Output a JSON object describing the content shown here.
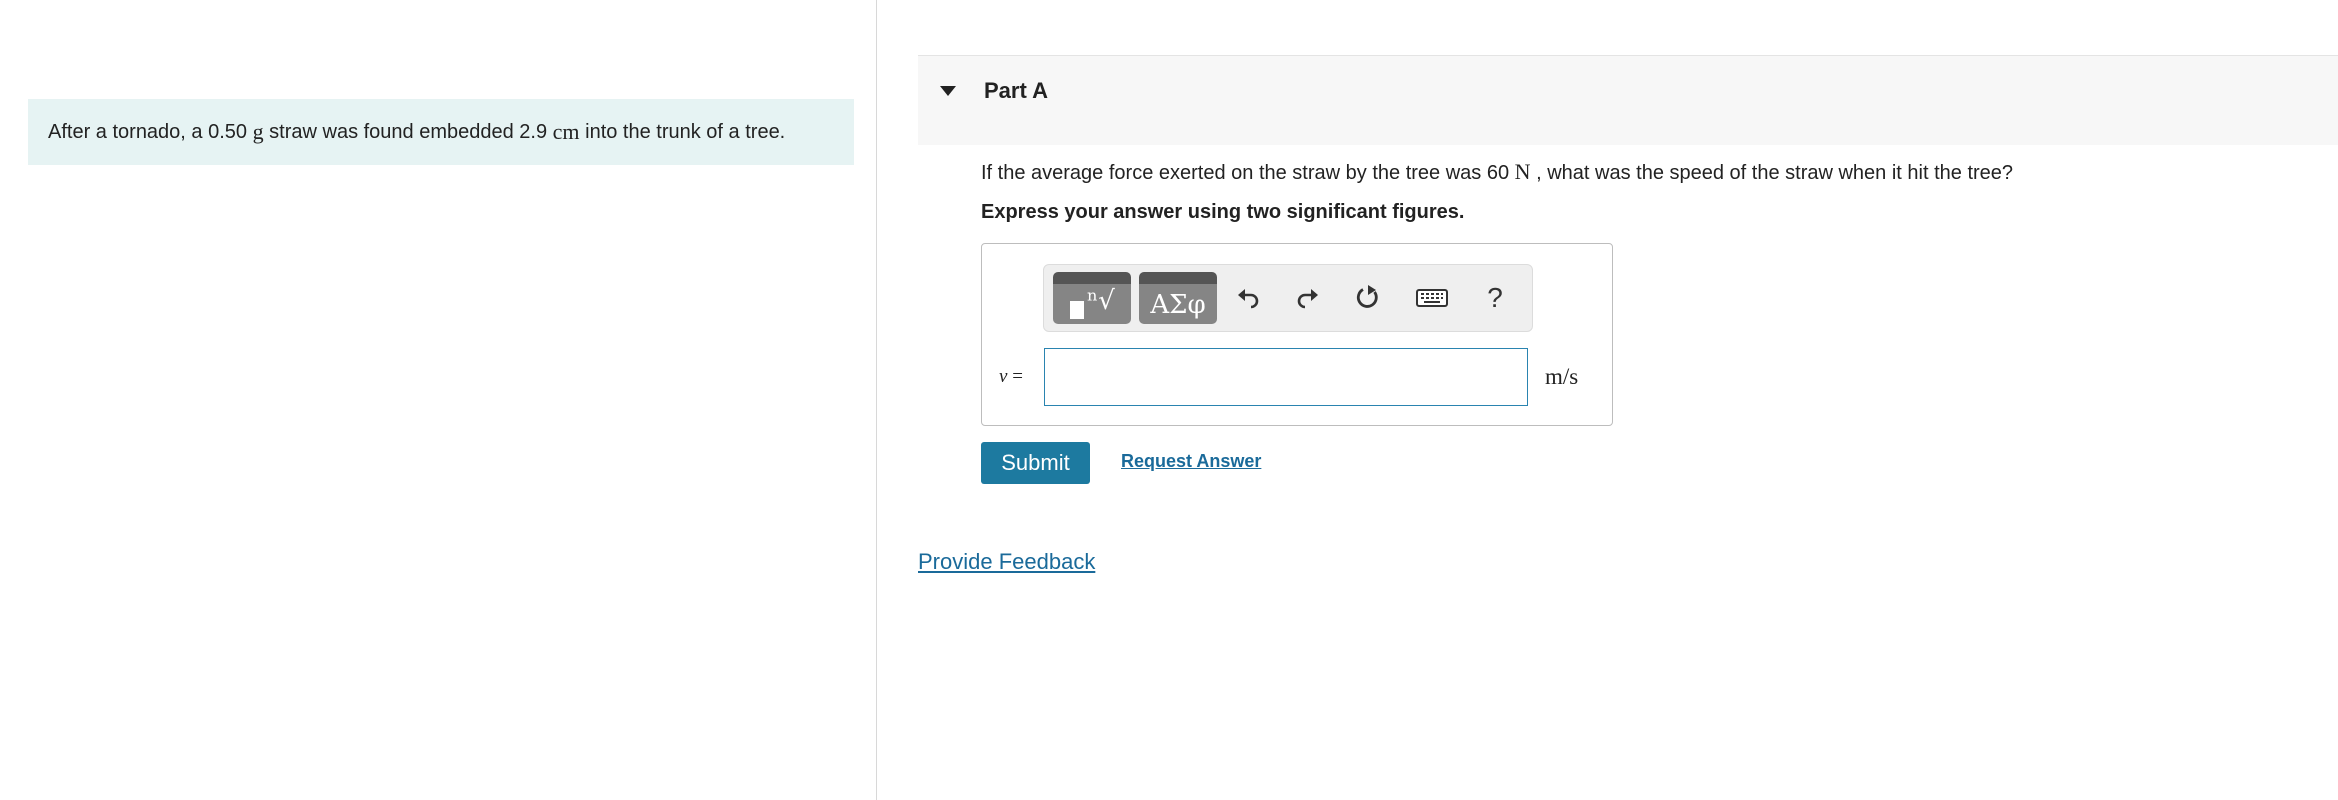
{
  "problem": {
    "pre": "After a tornado, a 0.50",
    "mass_unit": "g",
    "mid": "straw was found embedded 2.9",
    "depth_unit": "cm",
    "post": "into the trunk of a tree."
  },
  "part": {
    "title": "Part A"
  },
  "question": {
    "pre": "If the average force exerted on the straw by the tree was 60",
    "force_unit": "N",
    "post": ", what was the speed of the straw when it hit the tree?"
  },
  "instruction": "Express your answer using two significant figures.",
  "toolbar": {
    "templates_icon": "templates-icon",
    "symbols_label": "ΑΣφ",
    "help_label": "?"
  },
  "answer": {
    "variable": "v",
    "equals": "=",
    "value": "",
    "unit": "m/s"
  },
  "actions": {
    "submit_label": "Submit",
    "request_answer_label": "Request Answer"
  },
  "feedback_label": "Provide Feedback",
  "colors": {
    "problem_bg": "#e6f3f3",
    "accent": "#1d7aa0",
    "link": "#1a6a9a"
  }
}
